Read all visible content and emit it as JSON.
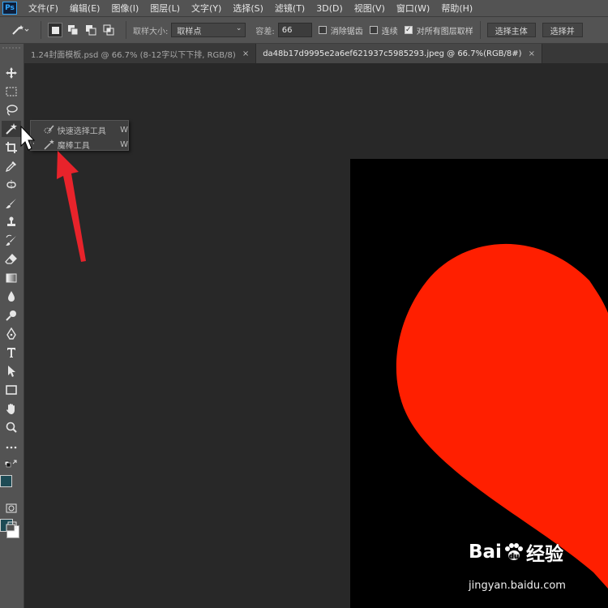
{
  "app": {
    "logo": "Ps"
  },
  "menu": [
    "文件(F)",
    "编辑(E)",
    "图像(I)",
    "图层(L)",
    "文字(Y)",
    "选择(S)",
    "滤镜(T)",
    "3D(D)",
    "视图(V)",
    "窗口(W)",
    "帮助(H)"
  ],
  "options": {
    "sample_size_label": "取样大小:",
    "sample_size_value": "取样点",
    "tolerance_label": "容差:",
    "tolerance_value": "66",
    "antialias_label": "消除锯齿",
    "antialias_checked": false,
    "contiguous_label": "连续",
    "contiguous_checked": false,
    "all_layers_label": "对所有图层取样",
    "all_layers_checked": true,
    "select_subject_label": "选择主体",
    "select_and_mask_label": "选择并"
  },
  "tabs": [
    {
      "label": "1.24封面模板.psd @ 66.7% (8-12字以下下排, RGB/8)",
      "active": false,
      "close": "×"
    },
    {
      "label": "da48b17d9995e2a6ef621937c5985293.jpeg @ 66.7%(RGB/8#)",
      "active": true,
      "close": "×"
    }
  ],
  "flyout": {
    "items": [
      {
        "label": "快速选择工具",
        "shortcut": "W",
        "icon": "quick-selection-icon"
      },
      {
        "label": "魔棒工具",
        "shortcut": "W",
        "icon": "magic-wand-icon"
      }
    ]
  },
  "colors": {
    "foreground": "#1e4b55",
    "background": "#ffffff",
    "heart": "#ff1f00",
    "arrow": "#e8232b"
  },
  "watermark": {
    "logo_text_1": "Bai",
    "logo_text_2": "经验",
    "url": "jingyan.baidu.com"
  }
}
